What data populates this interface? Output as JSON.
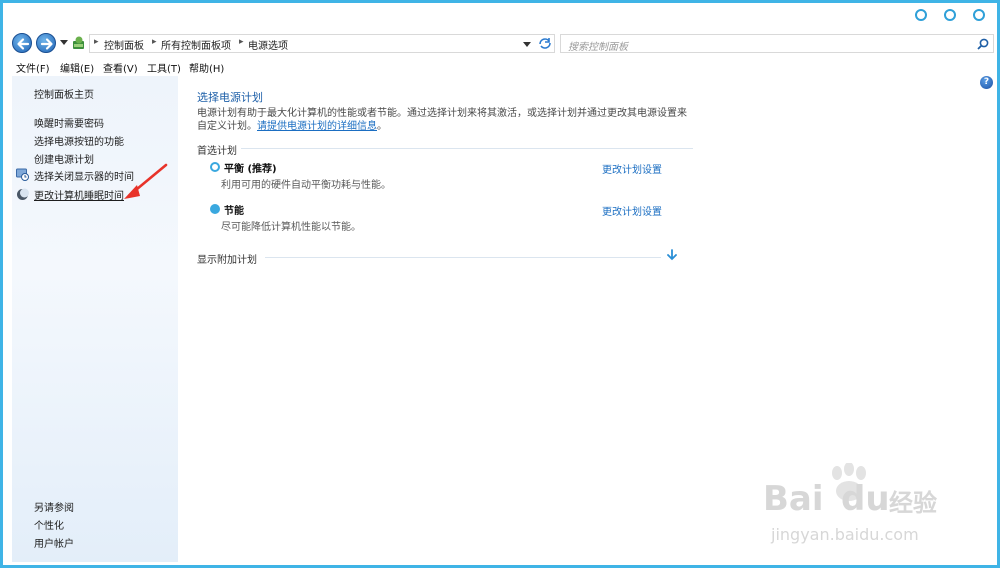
{
  "address": {
    "crumbs": [
      "控制面板",
      "所有控制面板项",
      "电源选项"
    ],
    "search_placeholder": "搜索控制面板"
  },
  "menu": [
    "文件(F)",
    "编辑(E)",
    "查看(V)",
    "工具(T)",
    "帮助(H)"
  ],
  "sidebar": {
    "home": "控制面板主页",
    "links": [
      {
        "label": "唤醒时需要密码",
        "icon": ""
      },
      {
        "label": "选择电源按钮的功能",
        "icon": ""
      },
      {
        "label": "创建电源计划",
        "icon": ""
      },
      {
        "label": "选择关闭显示器的时间",
        "icon": "monitor-clock-icon"
      },
      {
        "label": "更改计算机睡眠时间",
        "icon": "moon-icon"
      }
    ],
    "see_also_title": "另请参阅",
    "see_also": [
      "个性化",
      "用户帐户"
    ]
  },
  "main": {
    "heading": "选择电源计划",
    "description": "电源计划有助于最大化计算机的性能或者节能。通过选择计划来将其激活，或选择计划并通过更改其电源设置来自定义计划。",
    "description_link": "请提供电源计划的详细信息",
    "description_end": "。",
    "preferred_label": "首选计划",
    "plans": [
      {
        "name": "平衡 (推荐)",
        "desc": "利用可用的硬件自动平衡功耗与性能。",
        "selected": true,
        "link": "更改计划设置"
      },
      {
        "name": "节能",
        "desc": "尽可能降低计算机性能以节能。",
        "selected": false,
        "link": "更改计划设置"
      }
    ],
    "extra_label": "显示附加计划"
  },
  "watermark": {
    "brand": "Bai",
    "brand2": "du",
    "suffix": "经验",
    "url": "jingyan.baidu.com"
  },
  "colors": {
    "accent": "#3aa8df",
    "link": "#1b6ec2",
    "heading": "#1d5fa8",
    "annotation": "#e8332a"
  }
}
